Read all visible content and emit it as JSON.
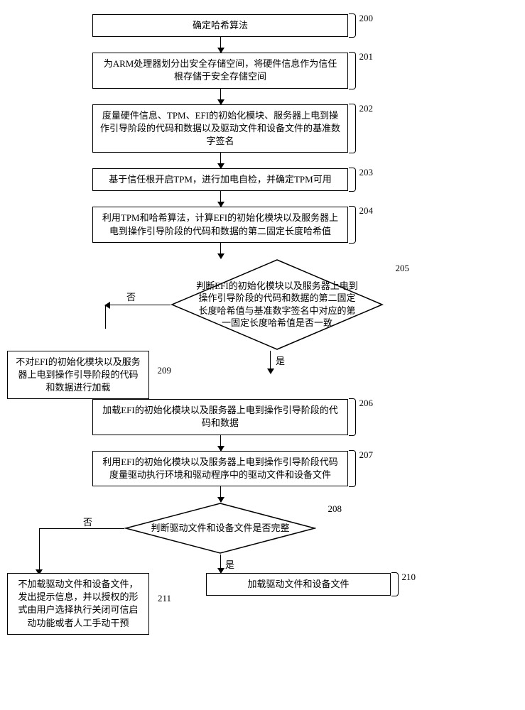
{
  "steps": {
    "s200": "确定哈希算法",
    "s201": "为ARM处理器划分出安全存储空间，将硬件信息作为信任根存储于安全存储空间",
    "s202": "度量硬件信息、TPM、EFI的初始化模块、服务器上电到操作引导阶段的代码和数据以及驱动文件和设备文件的基准数字签名",
    "s203": "基于信任根开启TPM，进行加电自检，并确定TPM可用",
    "s204": "利用TPM和哈希算法，计算EFI的初始化模块以及服务器上电到操作引导阶段的代码和数据的第二固定长度哈希值",
    "s205": "判断EFI的初始化模块以及服务器上电到操作引导阶段的代码和数据的第二固定长度哈希值与基准数字签名中对应的第一固定长度哈希值是否一致",
    "s206": "加载EFI的初始化模块以及服务器上电到操作引导阶段的代码和数据",
    "s207": "利用EFI的初始化模块以及服务器上电到操作引导阶段代码度量驱动执行环境和驱动程序中的驱动文件和设备文件",
    "s208": "判断驱动文件和设备文件是否完整",
    "s209": "不对EFI的初始化模块以及服务器上电到操作引导阶段的代码和数据进行加载",
    "s210": "加载驱动文件和设备文件",
    "s211": "不加载驱动文件和设备文件，发出提示信息，并以授权的形式由用户选择执行关闭可信启动功能或者人工手动干预"
  },
  "numbers": {
    "n200": "200",
    "n201": "201",
    "n202": "202",
    "n203": "203",
    "n204": "204",
    "n205": "205",
    "n206": "206",
    "n207": "207",
    "n208": "208",
    "n209": "209",
    "n210": "210",
    "n211": "211"
  },
  "labels": {
    "yes": "是",
    "no": "否"
  },
  "chart_data": {
    "type": "flowchart",
    "nodes": [
      {
        "id": "200",
        "shape": "rect",
        "text_ref": "steps.s200"
      },
      {
        "id": "201",
        "shape": "rect",
        "text_ref": "steps.s201"
      },
      {
        "id": "202",
        "shape": "rect",
        "text_ref": "steps.s202"
      },
      {
        "id": "203",
        "shape": "rect",
        "text_ref": "steps.s203"
      },
      {
        "id": "204",
        "shape": "rect",
        "text_ref": "steps.s204"
      },
      {
        "id": "205",
        "shape": "diamond",
        "text_ref": "steps.s205"
      },
      {
        "id": "206",
        "shape": "rect",
        "text_ref": "steps.s206"
      },
      {
        "id": "207",
        "shape": "rect",
        "text_ref": "steps.s207"
      },
      {
        "id": "208",
        "shape": "diamond",
        "text_ref": "steps.s208"
      },
      {
        "id": "209",
        "shape": "rect",
        "text_ref": "steps.s209"
      },
      {
        "id": "210",
        "shape": "rect",
        "text_ref": "steps.s210"
      },
      {
        "id": "211",
        "shape": "rect",
        "text_ref": "steps.s211"
      }
    ],
    "edges": [
      {
        "from": "200",
        "to": "201"
      },
      {
        "from": "201",
        "to": "202"
      },
      {
        "from": "202",
        "to": "203"
      },
      {
        "from": "203",
        "to": "204"
      },
      {
        "from": "204",
        "to": "205"
      },
      {
        "from": "205",
        "to": "206",
        "label": "是"
      },
      {
        "from": "205",
        "to": "209",
        "label": "否"
      },
      {
        "from": "206",
        "to": "207"
      },
      {
        "from": "207",
        "to": "208"
      },
      {
        "from": "208",
        "to": "210",
        "label": "是"
      },
      {
        "from": "208",
        "to": "211",
        "label": "否"
      }
    ]
  }
}
